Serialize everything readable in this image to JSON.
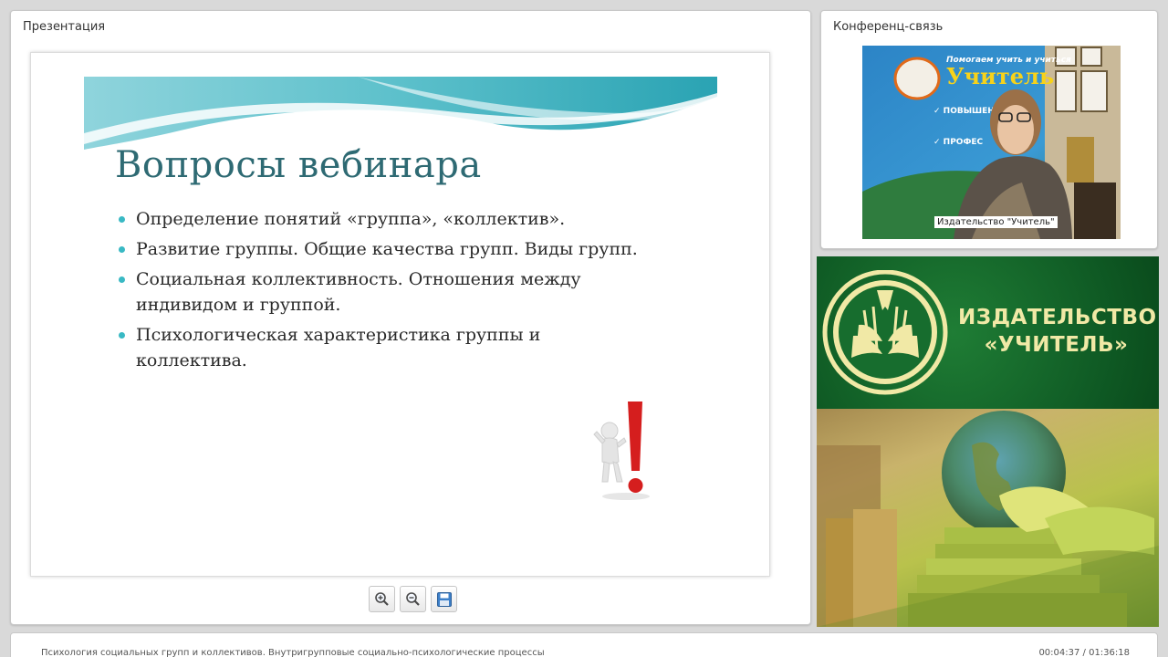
{
  "presentation": {
    "panel_title": "Презентация",
    "slide": {
      "title": "Вопросы вебинара",
      "bullets": [
        "Определение понятий «группа», «коллектив».",
        "Развитие группы. Общие качества групп. Виды групп.",
        "Социальная коллективность. Отношения между индивидом и группой.",
        "Психологическая характеристика группы и коллектива."
      ],
      "accent_color": "#39b9c4",
      "title_color": "#2e6a73"
    },
    "toolbar": {
      "zoom_in_icon": "zoom-in-icon",
      "zoom_out_icon": "zoom-out-icon",
      "save_icon": "save-icon"
    }
  },
  "conference": {
    "panel_title": "Конференц-связь",
    "video_caption": "Издательство \"Учитель\""
  },
  "banner": {
    "line1": "ИЗДАТЕЛЬСТВО",
    "line2": "«УЧИТЕЛЬ»",
    "brand_color": "#f1e9a6",
    "background_color": "#0f5a24"
  },
  "status": {
    "lecture_title": "Психология социальных групп и коллективов. Внутригрупповые социально-психологические процессы",
    "timecode": "00:04:37 / 01:36:18"
  }
}
